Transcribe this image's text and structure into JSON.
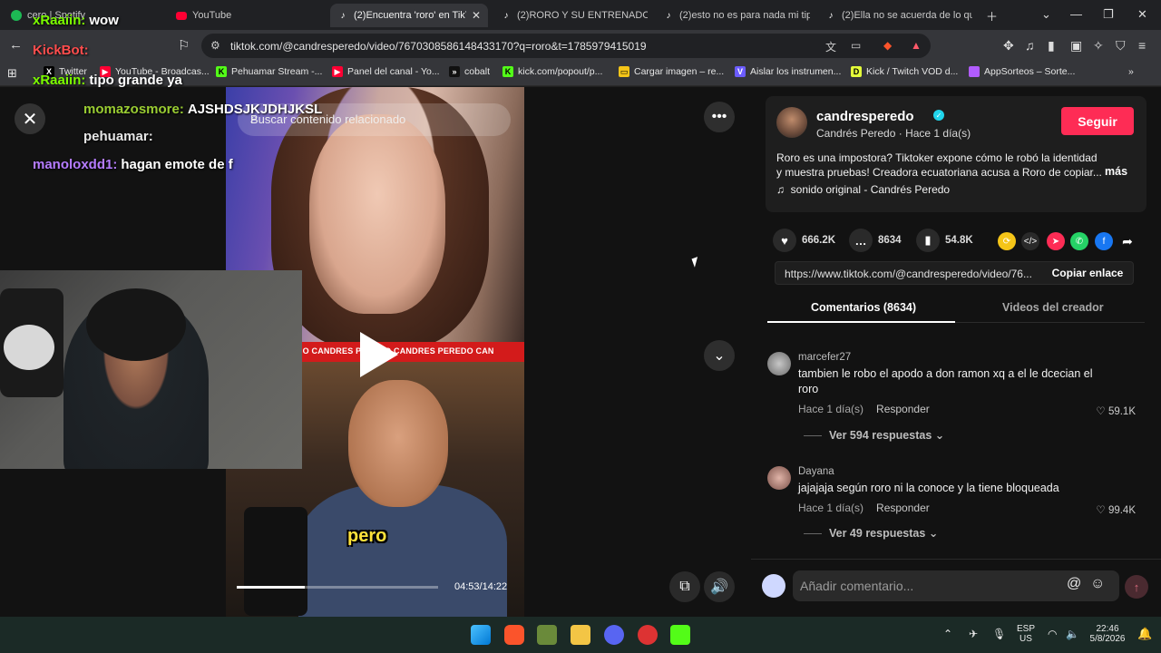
{
  "browser": {
    "tabs": [
      {
        "label": "cero | Spotify",
        "icon": "spotify-icon"
      },
      {
        "label": "YouTube",
        "icon": "youtube-icon"
      },
      {
        "label": "(2)Encuentra 'roro' en TikTo",
        "icon": "tiktok-icon",
        "active": true
      },
      {
        "label": "(2)RORO Y SU ENTRENADOR SE",
        "icon": "tiktok-icon"
      },
      {
        "label": "(2)esto no es para nada mi tipo",
        "icon": "tiktok-icon"
      },
      {
        "label": "(2)Ella no se acuerda de lo que",
        "icon": "tiktok-icon"
      }
    ],
    "url": "tiktok.com/@candresperedo/video/7670308586148433170?q=roro&t=1785979415019",
    "bookmarks": [
      {
        "label": "Twitter",
        "color": "#000000",
        "glyph": "X"
      },
      {
        "label": "YouTube - Broadcas...",
        "color": "#ff0033",
        "glyph": "▶"
      },
      {
        "label": "Pehuamar Stream -...",
        "color": "#53fc18",
        "glyph": "K"
      },
      {
        "label": "Panel del canal - Yo...",
        "color": "#ff0033",
        "glyph": "▶"
      },
      {
        "label": "cobalt",
        "color": "#111111",
        "glyph": ">>"
      },
      {
        "label": "kick.com/popout/p...",
        "color": "#53fc18",
        "glyph": "K"
      },
      {
        "label": "Cargar imagen – re...",
        "color": "#f5c518",
        "glyph": "▭"
      },
      {
        "label": "Aislar los instrumen...",
        "color": "#6b5cff",
        "glyph": "V"
      },
      {
        "label": "Kick / Twitch VOD d...",
        "color": "#e4ff3a",
        "glyph": "D"
      },
      {
        "label": "AppSorteos – Sorte...",
        "color": "#b15cff",
        "glyph": "●"
      }
    ]
  },
  "chat": [
    {
      "user": "xRaaiin:",
      "color": "#7cfc00",
      "message": "wow"
    },
    {
      "user": "KickBot:",
      "color": "#ff4d4d",
      "message": ""
    },
    {
      "user": "xRaaiin:",
      "color": "#7cfc00",
      "message": "tipo grande ya"
    },
    {
      "user": "momazosmore:",
      "color": "#9acd32",
      "message": "AJSHDSJKJDHJKSL"
    },
    {
      "user": "pehuamar:",
      "color": "#e6e6e6",
      "message": ""
    },
    {
      "user": "manoloxdd1:",
      "color": "#b57cff",
      "message": "hagan emote de f"
    }
  ],
  "video": {
    "search_placeholder": "Buscar contenido relacionado",
    "banner_text": "CANDRES PEREDO   CANDRES PEREDO   CANDRES PEREDO   CAN",
    "caption": "pero",
    "time": "04:53/14:22",
    "progress": 0.34
  },
  "author": {
    "username": "candresperedo",
    "display_name": "Candrés Peredo",
    "time_ago": "Hace 1 día(s)",
    "follow_label": "Seguir",
    "description": "Roro es una impostora? Tiktoker expone cómo le robó la identidad y muestra pruebas! Creadora ecuatoriana acusa a Roro de copiar...",
    "more_label": "más",
    "music": "sonido original - Candrés Peredo"
  },
  "stats": {
    "likes": "666.2K",
    "comments": "8634",
    "saves": "54.8K"
  },
  "link": {
    "url": "https://www.tiktok.com/@candresperedo/video/76...",
    "copy_label": "Copiar enlace"
  },
  "panel_tabs": {
    "comments": "Comentarios (8634)",
    "videos": "Videos del creador"
  },
  "comments": [
    {
      "user": "marcefer27",
      "text": "tambien le robo el apodo a don ramon xq a el le dcecian el roro",
      "time": "Hace 1 día(s)",
      "reply": "Responder",
      "likes": "59.1K",
      "replies": "Ver 594 respuestas"
    },
    {
      "user": "Dayana",
      "text": "jajajaja según roro ni la conoce y la tiene bloqueada",
      "time": "Hace 1 día(s)",
      "reply": "Responder",
      "likes": "99.4K",
      "replies": "Ver 49 respuestas"
    }
  ],
  "comment_box": {
    "placeholder": "Añadir comentario..."
  },
  "taskbar": {
    "lang": "ESP",
    "region": "US",
    "time": "22:46",
    "date": "5/8/2026"
  }
}
